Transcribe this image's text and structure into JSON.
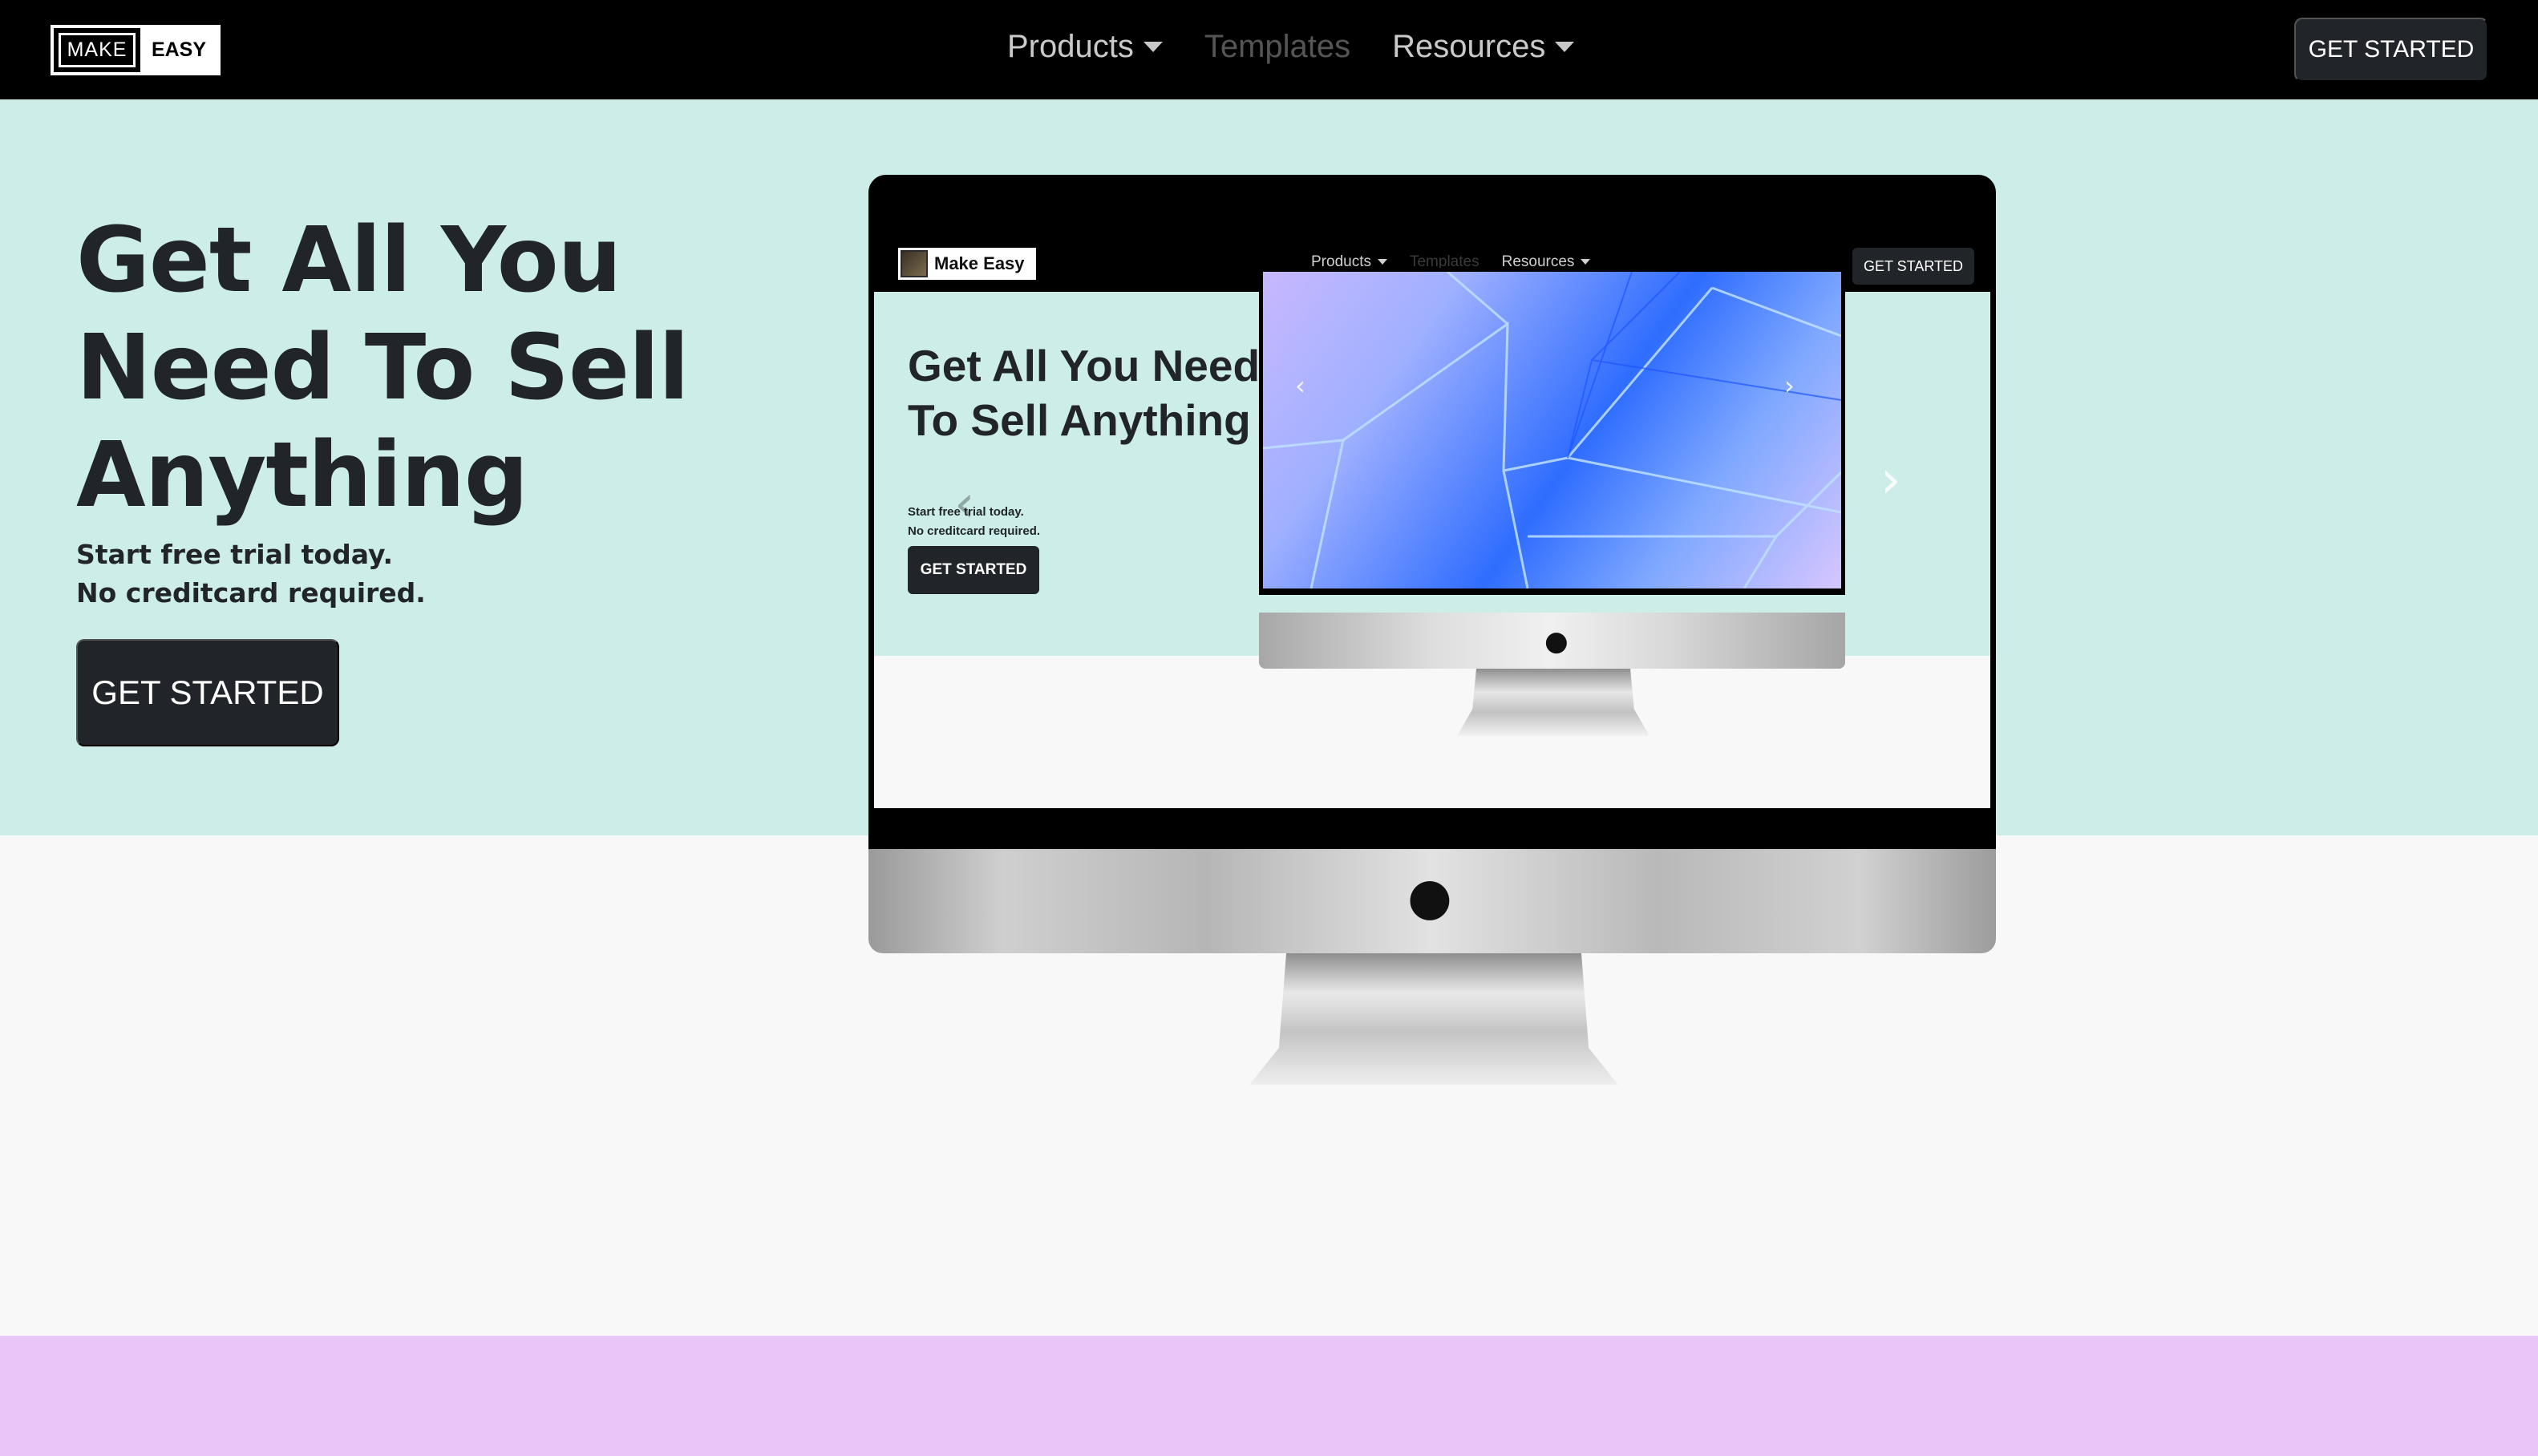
{
  "navbar": {
    "logo_make": "MAKE",
    "logo_easy": "EASY",
    "links": [
      {
        "label": "Products",
        "dropdown": true
      },
      {
        "label": "Templates",
        "dropdown": false
      },
      {
        "label": "Resources",
        "dropdown": true
      }
    ],
    "cta_label": "GET STARTED"
  },
  "hero": {
    "title": "Get All You Need To Sell Anything",
    "sub_line1": "Start free trial today.",
    "sub_line2": "No creditcard required.",
    "cta_label": "GET STARTED"
  },
  "preview": {
    "logo_label": "Make Easy",
    "links": [
      "Products",
      "Templates",
      "Resources"
    ],
    "cta_label": "GET STARTED",
    "title": "Get All You Need To Sell Anything",
    "sub_line1": "Start free trial today.",
    "sub_line2": "No creditcard required.",
    "button_label": "GET STARTED"
  },
  "colors": {
    "hero_bg": "#cdeee8",
    "page_bg": "#f8f8f8",
    "footer_band": "#e9c6f8",
    "button_dark": "#212529"
  },
  "icons": {
    "apple": "apple-logo-icon",
    "prev": "chevron-left-icon",
    "next": "chevron-right-icon"
  }
}
